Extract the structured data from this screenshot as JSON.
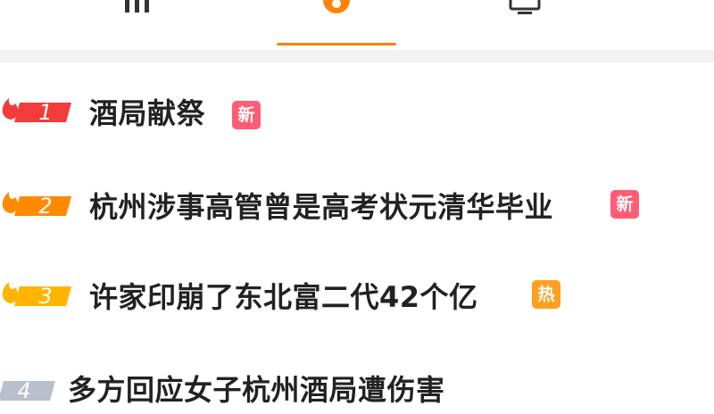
{
  "colors": {
    "accent": "#ff8200",
    "badge_new": "#ff5d75",
    "badge_hot": "#ffa020",
    "rank_1": "#f23c3c",
    "rank_2": "#ff8a00",
    "rank_3": "#ffb400",
    "rank_4": "#b9bfcc",
    "text": "#222222"
  },
  "tabs": [
    {
      "icon": "bars-icon",
      "active": false
    },
    {
      "icon": "fire-icon",
      "active": true
    },
    {
      "icon": "monitor-icon",
      "active": false
    }
  ],
  "list": [
    {
      "rank": "1",
      "title": "酒局献祭",
      "badge": "新",
      "badge_type": "new"
    },
    {
      "rank": "2",
      "title": "杭州涉事高管曾是高考状元清华毕业",
      "badge": "新",
      "badge_type": "new"
    },
    {
      "rank": "3",
      "title": "许家印崩了东北富二代42个亿",
      "badge": "热",
      "badge_type": "hot"
    },
    {
      "rank": "4",
      "title": "多方回应女子杭州酒局遭伤害",
      "badge": "",
      "badge_type": ""
    }
  ]
}
